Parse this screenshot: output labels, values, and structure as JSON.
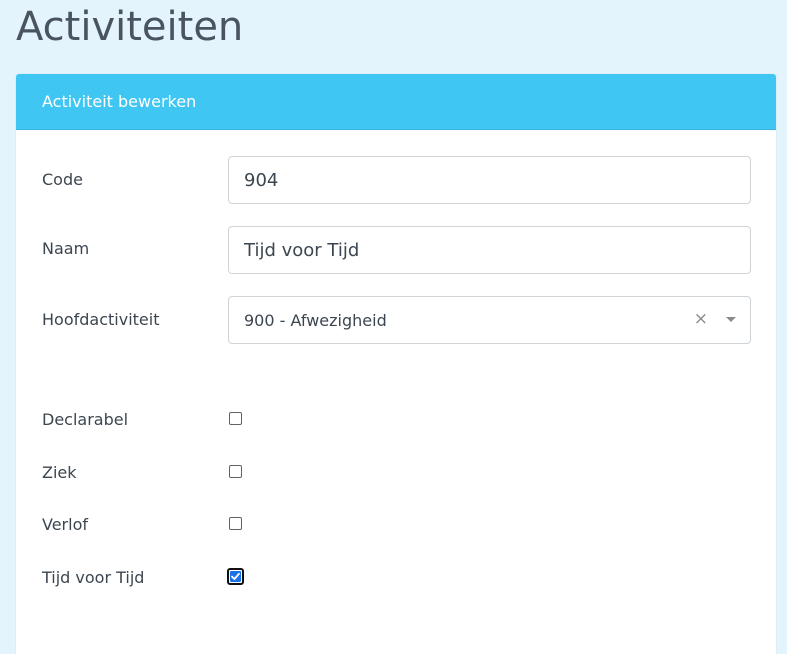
{
  "page": {
    "title": "Activiteiten"
  },
  "card": {
    "header": "Activiteit bewerken"
  },
  "form": {
    "code": {
      "label": "Code",
      "value": "904"
    },
    "naam": {
      "label": "Naam",
      "value": "Tijd voor Tijd"
    },
    "hoofdactiviteit": {
      "label": "Hoofdactiviteit",
      "value": "900 - Afwezigheid",
      "clear_glyph": "×"
    },
    "checkboxes": [
      {
        "label": "Declarabel",
        "checked": false
      },
      {
        "label": "Ziek",
        "checked": false
      },
      {
        "label": "Verlof",
        "checked": false
      },
      {
        "label": "Tijd voor Tijd",
        "checked": true
      }
    ]
  },
  "colors": {
    "background": "#e3f4fd",
    "header": "#40c6f3",
    "checkbox_checked": "#1a73e8"
  },
  "icons": {
    "clear": "close-icon",
    "dropdown": "chevron-down-icon",
    "check": "check-icon"
  }
}
